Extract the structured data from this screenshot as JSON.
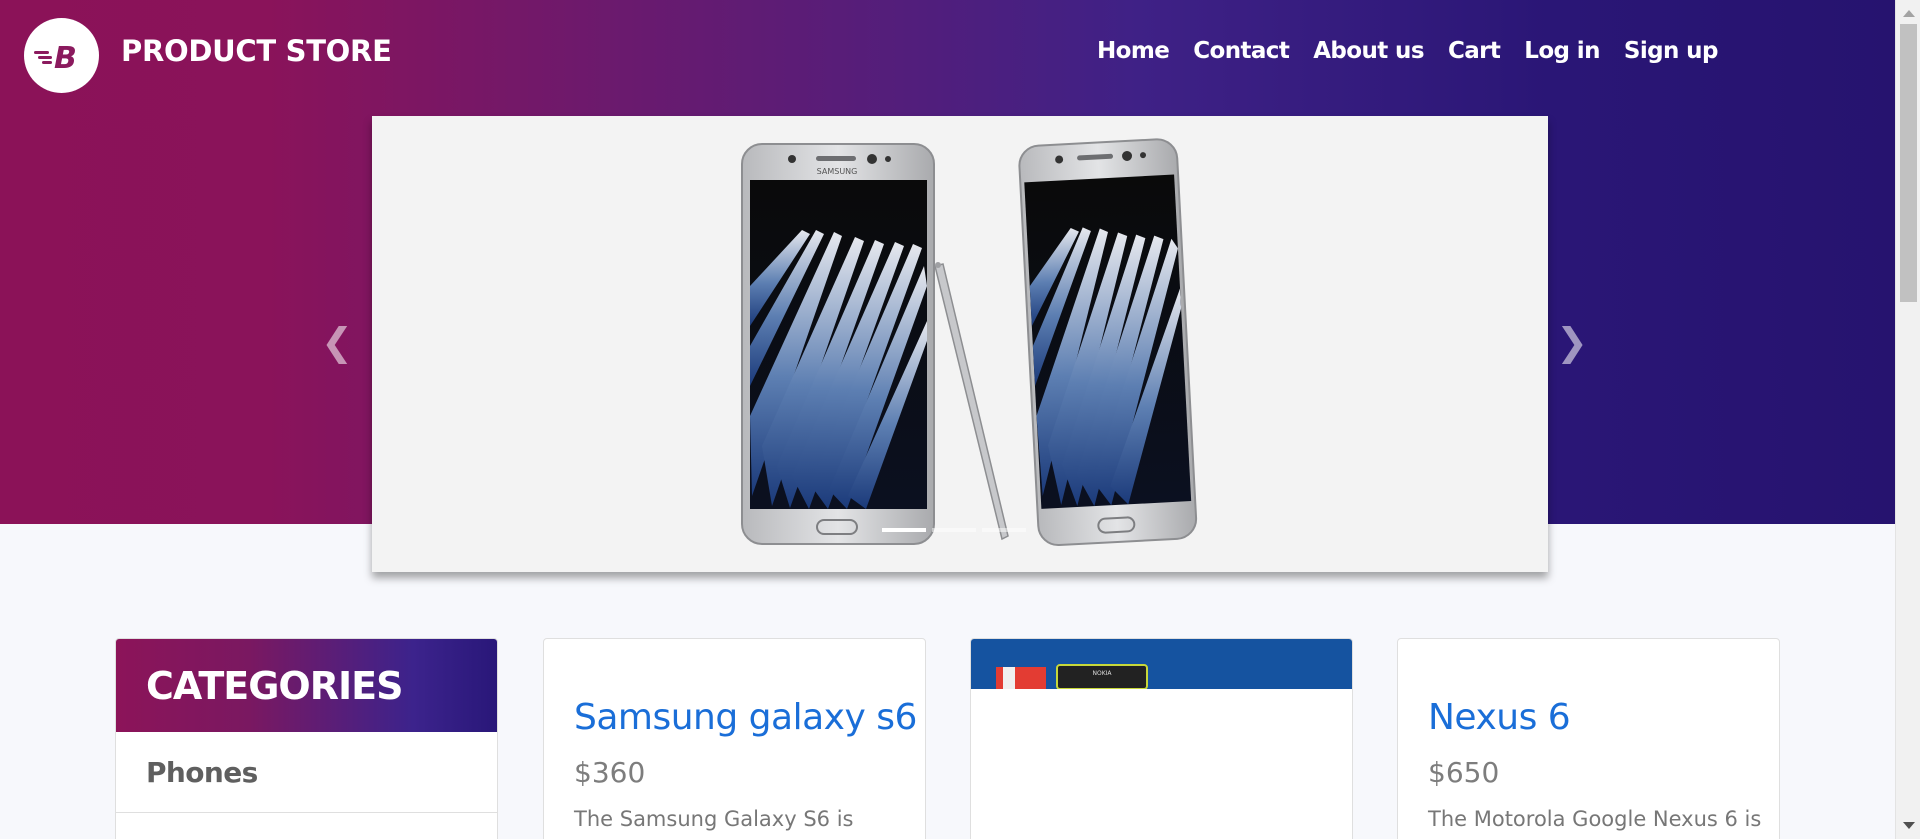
{
  "brand": {
    "name": "PRODUCT STORE",
    "logo_letter": "B"
  },
  "nav": {
    "items": [
      {
        "label": "Home"
      },
      {
        "label": "Contact"
      },
      {
        "label": "About us"
      },
      {
        "label": "Cart"
      },
      {
        "label": "Log in"
      },
      {
        "label": "Sign up"
      }
    ]
  },
  "carousel": {
    "prev_icon": "chevron-left-icon",
    "next_icon": "chevron-right-icon",
    "prev_glyph": "❮",
    "next_glyph": "❯",
    "slide_count": 3,
    "active_index": 0,
    "phone_brand_text": "SAMSUNG"
  },
  "categories": {
    "title": "CATEGORIES",
    "items": [
      {
        "label": "Phones"
      }
    ]
  },
  "products": [
    {
      "title": "Samsung galaxy s6",
      "price": "$360",
      "description": "The Samsung Galaxy S6 is"
    },
    {
      "title": "",
      "price": "",
      "description": "",
      "image_label": "NOKIA"
    },
    {
      "title": "Nexus 6",
      "price": "$650",
      "description": "The Motorola Google Nexus 6 is"
    }
  ],
  "colors": {
    "gradient_start": "#8b1258",
    "gradient_end": "#26136f",
    "link_blue": "#1a6ed8"
  }
}
